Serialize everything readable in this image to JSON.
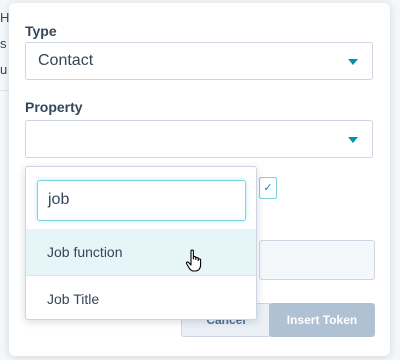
{
  "background": {
    "fragments": [
      "H",
      "s",
      "u"
    ]
  },
  "modal": {
    "type_label": "Type",
    "type_value": "Contact",
    "property_label": "Property",
    "property_value": ""
  },
  "dropdown": {
    "search_value": "job",
    "options": [
      {
        "label": "Job function",
        "hovered": true
      },
      {
        "label": "Job Title",
        "hovered": false
      }
    ]
  },
  "checkbox": {
    "checked": true,
    "icon": "check-icon"
  },
  "buttons": {
    "cancel_label": "Cancel",
    "insert_label": "Insert Token"
  },
  "colors": {
    "accent": "#0091ae",
    "text": "#33475b",
    "hover": "#e5f5f8",
    "disabled_button": "#b0c1d4"
  }
}
